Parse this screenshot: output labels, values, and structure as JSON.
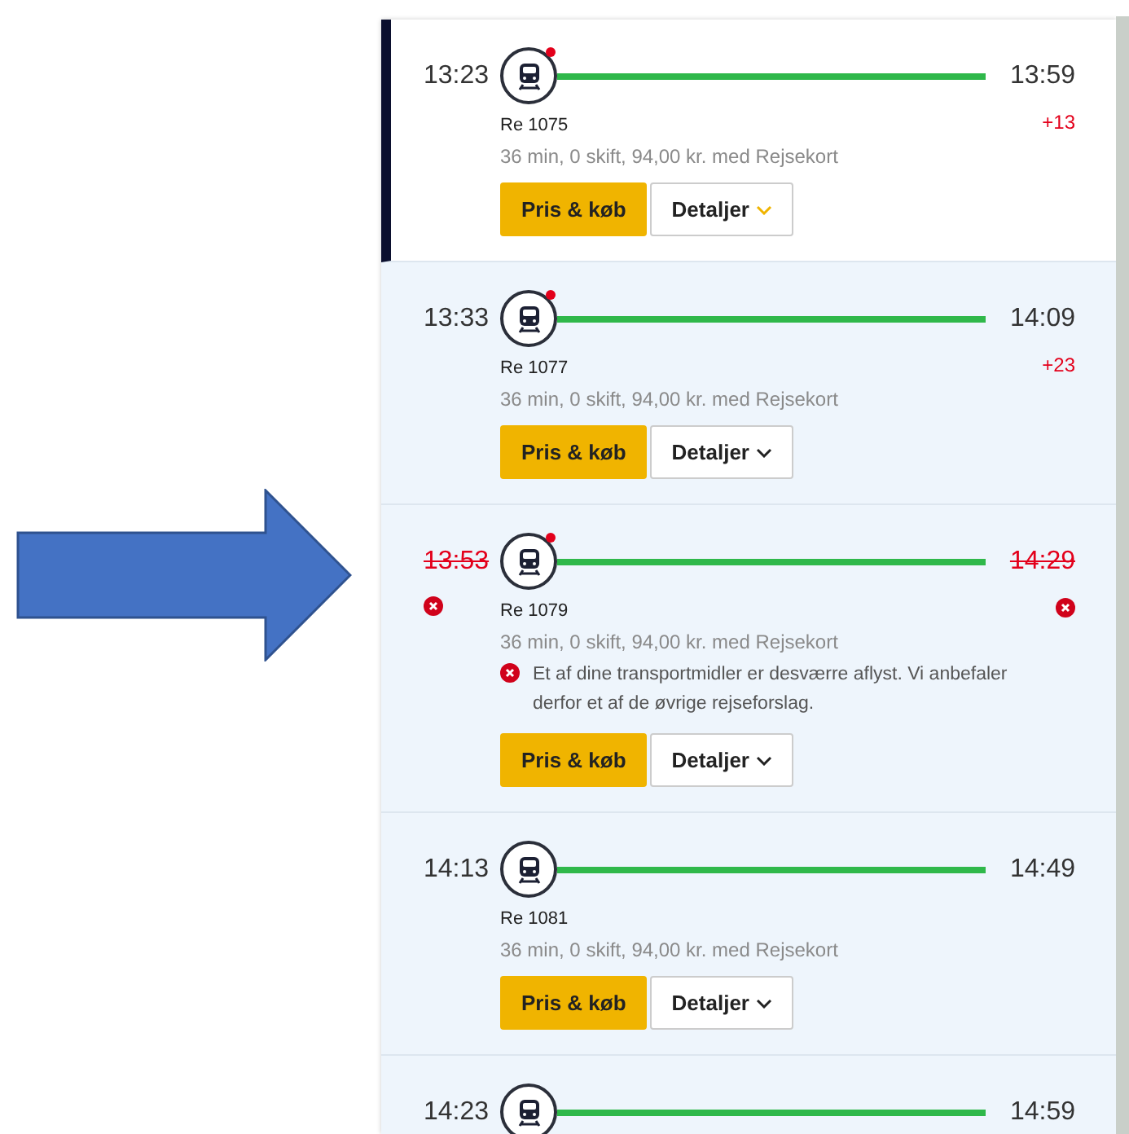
{
  "journeys": [
    {
      "selected": true,
      "cancelled": false,
      "alert": true,
      "departure": "13:23",
      "arrival": "13:59",
      "delay": "+13",
      "train": "Re 1075",
      "summary": "36 min, 0 skift, 94,00 kr. med Rejsekort",
      "buy_label": "Pris & køb",
      "details_label": "Detaljer"
    },
    {
      "selected": false,
      "cancelled": false,
      "alert": true,
      "departure": "13:33",
      "arrival": "14:09",
      "delay": "+23",
      "train": "Re 1077",
      "summary": "36 min, 0 skift, 94,00 kr. med Rejsekort",
      "buy_label": "Pris & køb",
      "details_label": "Detaljer"
    },
    {
      "selected": false,
      "cancelled": true,
      "alert": true,
      "departure": "13:53",
      "arrival": "14:29",
      "train": "Re 1079",
      "summary": "36 min, 0 skift, 94,00 kr. med Rejsekort",
      "message": "Et af dine transportmidler er desværre aflyst. Vi anbefaler derfor et af de øvrige rejseforslag.",
      "buy_label": "Pris & køb",
      "details_label": "Detaljer"
    },
    {
      "selected": false,
      "cancelled": false,
      "alert": false,
      "departure": "14:13",
      "arrival": "14:49",
      "train": "Re 1081",
      "summary": "36 min, 0 skift, 94,00 kr. med Rejsekort",
      "buy_label": "Pris & køb",
      "details_label": "Detaljer"
    },
    {
      "selected": false,
      "cancelled": false,
      "alert": false,
      "departure": "14:23",
      "arrival": "14:59"
    }
  ]
}
